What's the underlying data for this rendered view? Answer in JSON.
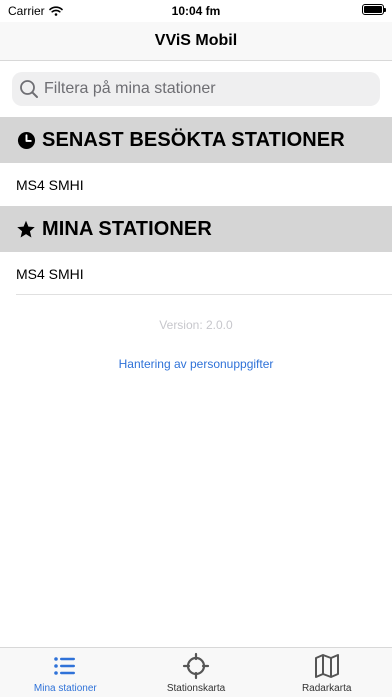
{
  "status_bar": {
    "carrier": "Carrier",
    "time": "10:04 fm"
  },
  "nav": {
    "title": "VViS Mobil"
  },
  "search": {
    "placeholder": "Filtera på mina stationer",
    "value": ""
  },
  "sections": [
    {
      "title": "SENAST BESÖKTA STATIONER",
      "icon": "clock-icon",
      "items": [
        {
          "label": "MS4 SMHI"
        }
      ]
    },
    {
      "title": "MINA STATIONER",
      "icon": "star-icon",
      "items": [
        {
          "label": "MS4 SMHI"
        }
      ]
    }
  ],
  "footer": {
    "version": "Version: 2.0.0",
    "privacy_link": "Hantering av personuppgifter"
  },
  "tabs": [
    {
      "label": "Mina stationer",
      "icon": "list-icon",
      "active": true
    },
    {
      "label": "Stationskarta",
      "icon": "crosshair-icon",
      "active": false
    },
    {
      "label": "Radarkarta",
      "icon": "map-icon",
      "active": false
    }
  ],
  "colors": {
    "accent": "#2f72d8",
    "section_header_bg": "#d5d5d5",
    "search_bg": "#efeff0"
  }
}
